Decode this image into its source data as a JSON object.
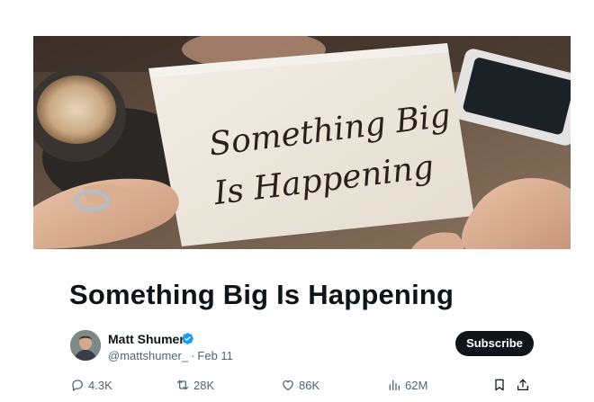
{
  "hero": {
    "image": "note-card-photo",
    "handwritten_line1": "Something Big",
    "handwritten_line2": "Is Happening"
  },
  "article": {
    "title": "Something Big Is Happening"
  },
  "author": {
    "name": "Matt Shumer",
    "handle": "@mattshumer_",
    "separator": "·",
    "date": "Feb 11",
    "verified": true,
    "verified_color": "#1d9bf0"
  },
  "subscribe_label": "Subscribe",
  "actions": {
    "replies": "4.3K",
    "reposts": "28K",
    "likes": "86K",
    "views": "62M"
  },
  "icons": [
    "comment-icon",
    "repost-icon",
    "heart-icon",
    "views-icon",
    "bookmark-icon",
    "share-icon",
    "verified-icon"
  ]
}
